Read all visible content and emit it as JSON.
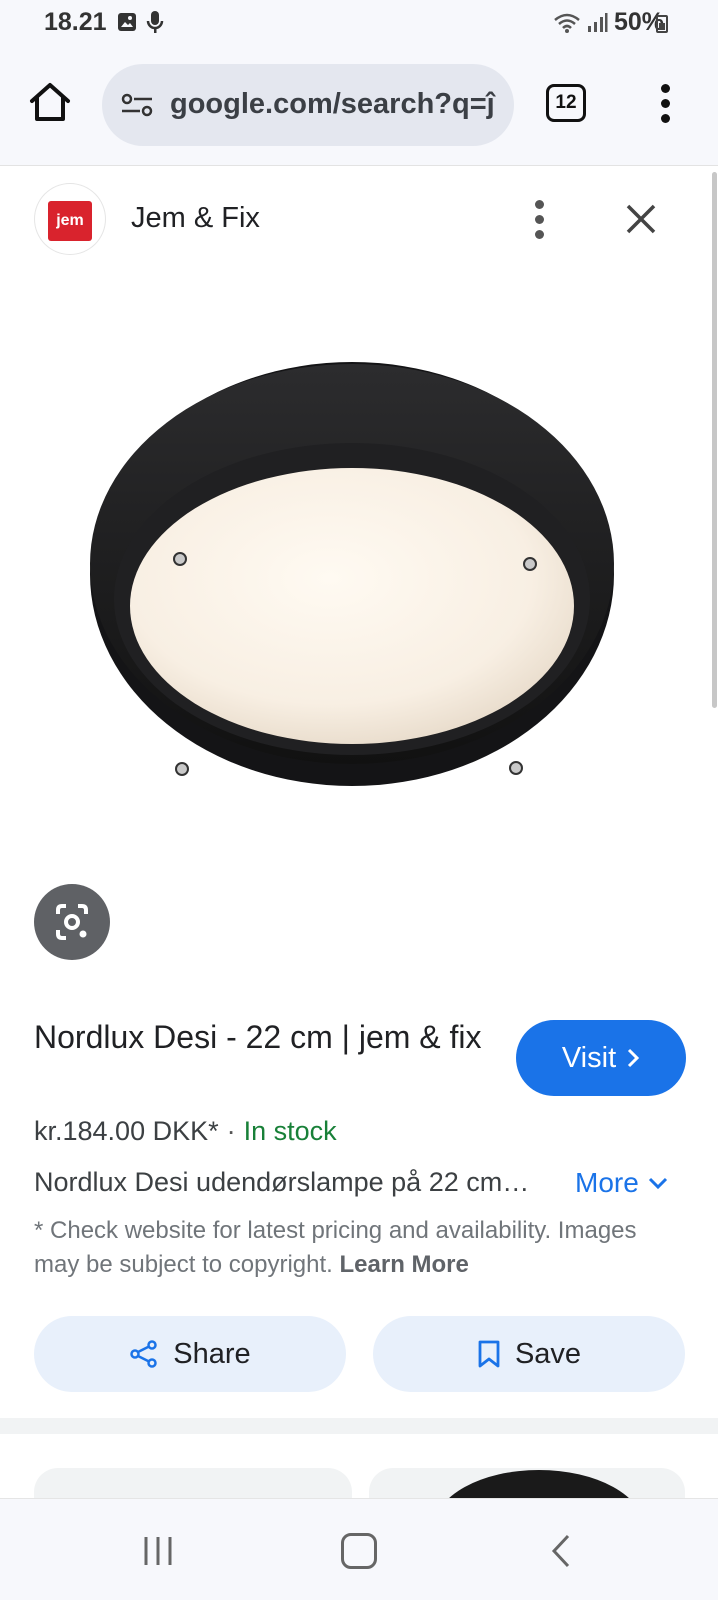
{
  "status_bar": {
    "time": "18.21",
    "battery": "50%"
  },
  "browser": {
    "url": "google.com/search?q=ĵ",
    "tab_count": "12"
  },
  "source": {
    "logo_text": "jem",
    "name": "Jem & Fix"
  },
  "product": {
    "title": "Nordlux Desi - 22 cm | jem & fix",
    "price": "kr.184.00 DKK*",
    "separator": "·",
    "stock": "In stock",
    "description": "Nordlux Desi udendørslampe på 22 cm…",
    "more_label": "More",
    "disclaimer": "* Check website for latest pricing and availability. Images may be subject to copyright.",
    "learn_more": "Learn More"
  },
  "actions": {
    "visit_label": "Visit",
    "share_label": "Share",
    "save_label": "Save"
  },
  "colors": {
    "accent": "#1a73e8",
    "stock_green": "#188038",
    "logo_red": "#d9232d"
  }
}
